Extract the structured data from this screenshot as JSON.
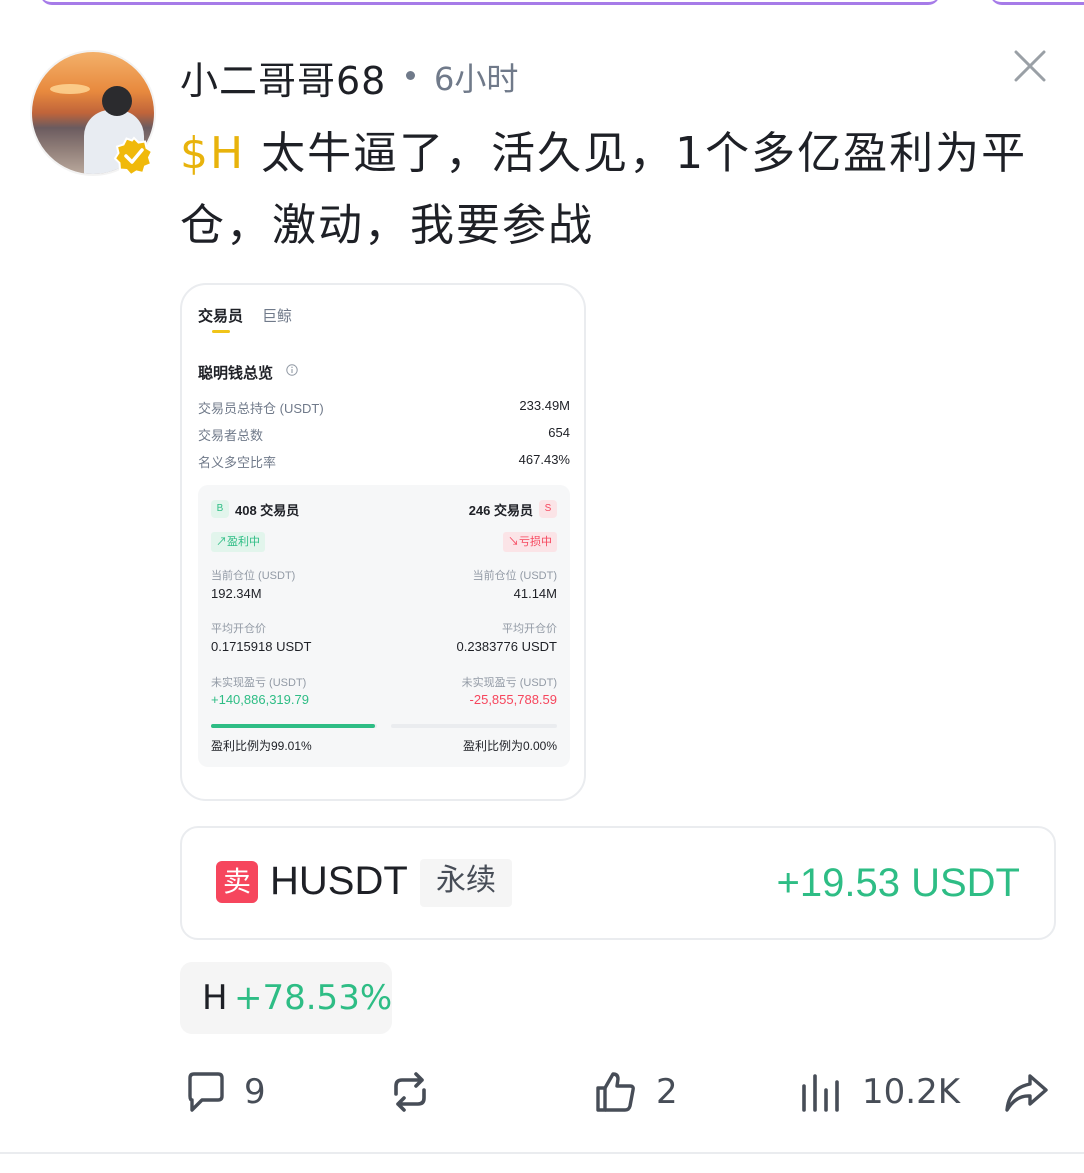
{
  "post": {
    "username": "小二哥哥68",
    "time_ago": "6小时",
    "cashtag": "$H",
    "text": " 太牛逼了，活久见，1个多亿盈利为平仓，激动，我要参战"
  },
  "embed": {
    "tabs": [
      "交易员",
      "巨鲸"
    ],
    "section_title": "聪明钱总览",
    "stats": [
      {
        "label": "交易员总持仓 (USDT)",
        "value": "233.49M"
      },
      {
        "label": "交易者总数",
        "value": "654"
      },
      {
        "label": "名义多空比率",
        "value": "467.43%"
      }
    ],
    "long": {
      "badge": "B",
      "count": "408 交易员",
      "status": "↗盈利中",
      "position_label": "当前仓位 (USDT)",
      "position_value": "192.34M",
      "avg_price_label": "平均开仓价",
      "avg_price_value": "0.1715918 USDT",
      "pnl_label": "未实现盈亏 (USDT)",
      "pnl_value": "+140,886,319.79",
      "profit_ratio": 0.9901,
      "ratio_text": "盈利比例为99.01%"
    },
    "short": {
      "badge": "S",
      "count": "246 交易员",
      "status": "↘亏损中",
      "position_label": "当前仓位 (USDT)",
      "position_value": "41.14M",
      "avg_price_label": "平均开仓价",
      "avg_price_value": "0.2383776 USDT",
      "pnl_label": "未实现盈亏 (USDT)",
      "pnl_value": "-25,855,788.59",
      "profit_ratio": 0.0,
      "ratio_text": "盈利比例为0.00%"
    }
  },
  "trade": {
    "side_icon": "卖",
    "pair": "HUSDT",
    "contract_type": "永续",
    "pnl": "+19.53 USDT"
  },
  "price_change": {
    "symbol": "H",
    "percent": "+78.53%"
  },
  "actions": {
    "comments": "9",
    "likes": "2",
    "views": "10.2K"
  },
  "colors": {
    "green": "#2ebd85",
    "red": "#f6465d",
    "gold": "#e8b30c"
  }
}
